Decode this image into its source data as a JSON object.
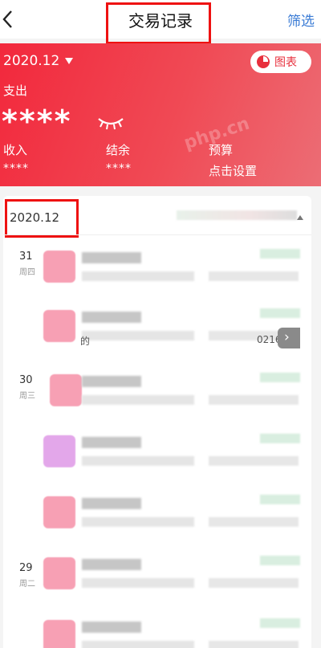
{
  "nav": {
    "title": "交易记录",
    "filter": "筛选"
  },
  "header": {
    "month": "2020.12",
    "chart_button": "图表",
    "expense_label": "支出",
    "expense_masked": "****",
    "watermark": "php.cn",
    "stats": [
      {
        "label": "收入",
        "value": "****"
      },
      {
        "label": "结余",
        "value": "****"
      },
      {
        "label": "预算",
        "value": "点击设置"
      }
    ]
  },
  "list": {
    "month": "2020.12",
    "dates": [
      {
        "day": "31",
        "weekday": "周四"
      },
      {
        "day": "30",
        "weekday": "周三"
      },
      {
        "day": "29",
        "weekday": "周二"
      }
    ],
    "row_snippets": {
      "left": "的",
      "right": "0216"
    }
  },
  "colors": {
    "brand_red": "#f2283c",
    "link_blue": "#3a7bd5",
    "highlight_box": "#ee1111"
  },
  "icons": [
    "back-chevron-icon",
    "caret-down-icon",
    "pie-chart-icon",
    "eye-closed-icon",
    "chevron-right-icon"
  ]
}
